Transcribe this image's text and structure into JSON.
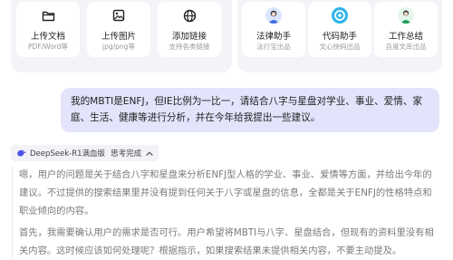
{
  "tools": [
    {
      "title": "上传文档",
      "sub": "PDF/Word等",
      "icon": "folder-icon"
    },
    {
      "title": "上传图片",
      "sub": "jpg/png等",
      "icon": "image-icon"
    },
    {
      "title": "添加链接",
      "sub": "支持各类链接",
      "icon": "globe-icon"
    }
  ],
  "assistants": [
    {
      "title": "法律助手",
      "sub": "法行宝出品",
      "icon": "law-avatar-icon"
    },
    {
      "title": "代码助手",
      "sub": "文心快码出品",
      "icon": "code-avatar-icon"
    },
    {
      "title": "工作总结",
      "sub": "百度文库出品",
      "icon": "work-avatar-icon"
    }
  ],
  "user_message": "我的MBTI是ENFJ，但IE比例为一比一，请结合八字与星盘对学业、事业、爱情、家庭、生活、健康等进行分析，并在今年给我提出一些建议。",
  "model_badge": {
    "model": "DeepSeek-R1满血版",
    "status": "思考完成"
  },
  "thinking": [
    "嗯，用户的问题是关于结合八字和星盘来分析ENFJ型人格的学业、事业、爱情等方面，并给出今年的建议。不过提供的搜索结果里并没有提到任何关于八字或星盘的信息，全都是关于ENFJ的性格特点和职业倾向的内容。",
    "首先，我需要确认用户的需求是否可行。用户希望将MBTI与八字、星盘结合，但现有的资料里没有相关内容。这时候应该如何处理呢？根据指示，如果搜索结果未提供相关内容，不要主动提及。"
  ],
  "colors": {
    "accent": "#4d53e8",
    "bubble": "#e3e4fb",
    "panel": "#f3f4f8"
  }
}
